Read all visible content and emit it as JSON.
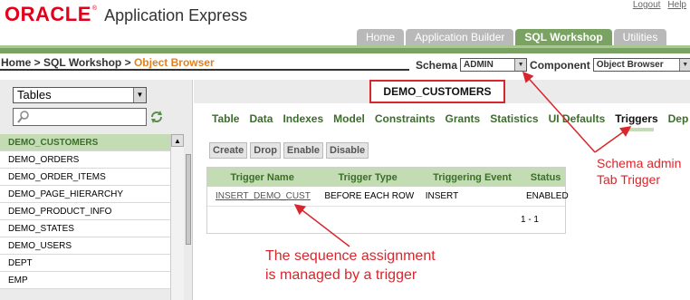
{
  "header": {
    "brand": "ORACLE",
    "brand_reg": "®",
    "product": "Application Express",
    "links": [
      "Logout",
      "Help"
    ]
  },
  "tabs": [
    {
      "label": "Home",
      "active": false
    },
    {
      "label": "Application Builder",
      "active": false
    },
    {
      "label": "SQL Workshop",
      "active": true
    },
    {
      "label": "Utilities",
      "active": false
    }
  ],
  "breadcrumb": {
    "home": "Home",
    "sep1": " > ",
    "workshop": "SQL Workshop",
    "sep2": " > ",
    "current": "Object Browser"
  },
  "schema": {
    "label": "Schema",
    "value": "ADMIN",
    "component_label": "Component",
    "component_value": "Object Browser"
  },
  "left": {
    "type_select": "Tables",
    "search_value": "",
    "objects": [
      "DEMO_CUSTOMERS",
      "DEMO_ORDERS",
      "DEMO_ORDER_ITEMS",
      "DEMO_PAGE_HIERARCHY",
      "DEMO_PRODUCT_INFO",
      "DEMO_STATES",
      "DEMO_USERS",
      "DEPT",
      "EMP"
    ],
    "selected": "DEMO_CUSTOMERS"
  },
  "object_title": "DEMO_CUSTOMERS",
  "object_tabs": [
    "Table",
    "Data",
    "Indexes",
    "Model",
    "Constraints",
    "Grants",
    "Statistics",
    "UI Defaults",
    "Triggers",
    "Dep"
  ],
  "active_object_tab": "Triggers",
  "actions": [
    "Create",
    "Drop",
    "Enable",
    "Disable"
  ],
  "triggers": {
    "columns": [
      "Trigger Name",
      "Trigger Type",
      "Triggering Event",
      "Status"
    ],
    "rows": [
      {
        "name": "INSERT_DEMO_CUST",
        "type": "BEFORE EACH ROW",
        "event": "INSERT",
        "status": "ENABLED"
      }
    ],
    "pager": "1 - 1"
  },
  "annotations": {
    "sequence_line1": "The sequence assignment",
    "sequence_line2": "is managed by a trigger",
    "schema_line1": "Schema admin",
    "schema_line2": "Tab Trigger"
  },
  "colors": {
    "oracle_red": "#e3001b",
    "tab_green": "#7aa363",
    "accent_green": "#3b6e2a",
    "selected_row": "#c4dcb4",
    "annotation_red": "#d9262c",
    "breadcrumb_current": "#e3801b"
  },
  "icons": {
    "search": "magnifier-icon",
    "refresh": "refresh-icon",
    "dropdown": "chevron-down-icon"
  }
}
